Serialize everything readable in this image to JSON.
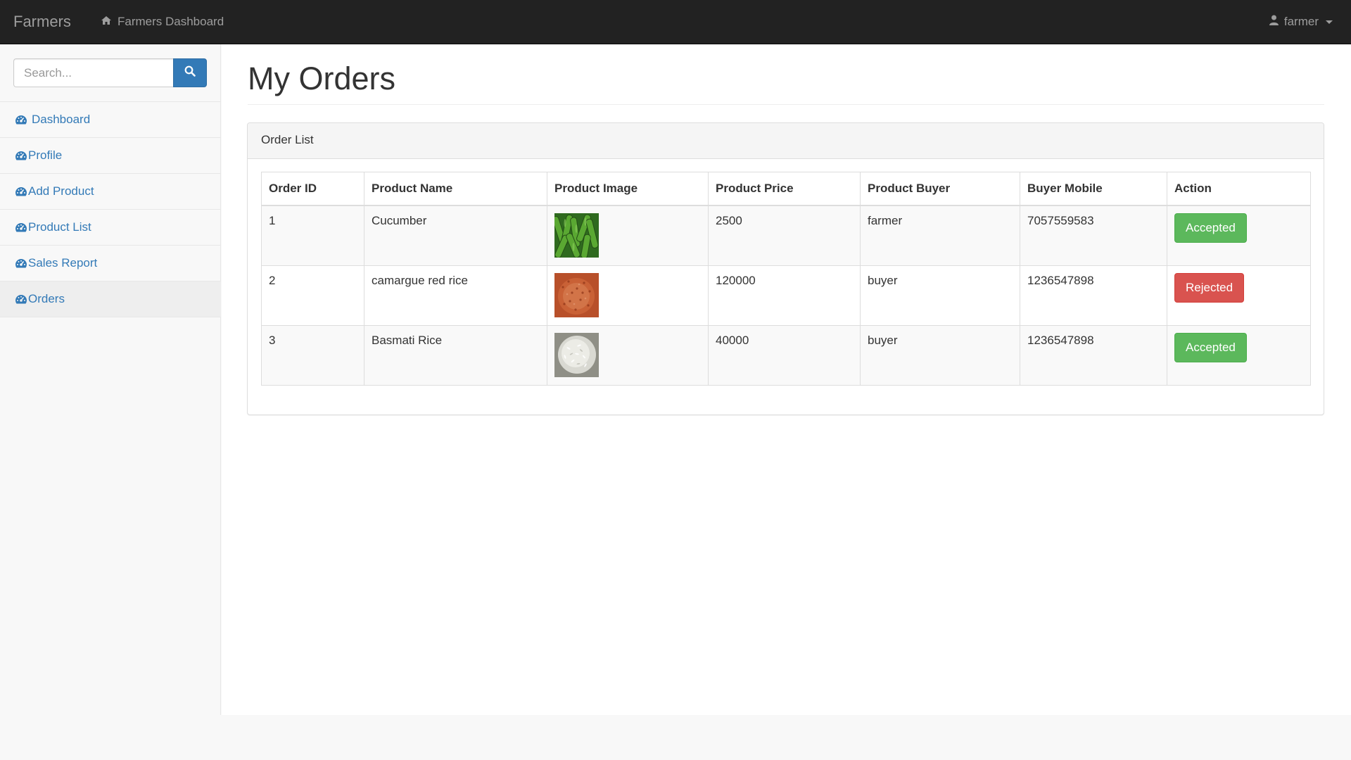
{
  "navbar": {
    "brand": "Farmers",
    "dashboard_link": "Farmers Dashboard",
    "user": "farmer"
  },
  "sidebar": {
    "search_placeholder": "Search...",
    "items": [
      {
        "label": "Dashboard",
        "icon": "dashboard-icon",
        "active": false
      },
      {
        "label": "Profile",
        "icon": "dashboard-icon",
        "active": false
      },
      {
        "label": "Add Product",
        "icon": "dashboard-icon",
        "active": false
      },
      {
        "label": "Product List",
        "icon": "dashboard-icon",
        "active": false
      },
      {
        "label": "Sales Report",
        "icon": "dashboard-icon",
        "active": false
      },
      {
        "label": "Orders",
        "icon": "dashboard-icon",
        "active": true
      }
    ]
  },
  "main": {
    "title": "My Orders",
    "panel_title": "Order List",
    "table": {
      "headers": [
        "Order ID",
        "Product Name",
        "Product Image",
        "Product Price",
        "Product Buyer",
        "Buyer Mobile",
        "Action"
      ],
      "rows": [
        {
          "id": "1",
          "name": "Cucumber",
          "image": "cucumber-image",
          "price": "2500",
          "buyer": "farmer",
          "mobile": "7057559583",
          "action": "Accepted",
          "status": "accepted"
        },
        {
          "id": "2",
          "name": "camargue red rice",
          "image": "red-rice-image",
          "price": "120000",
          "buyer": "buyer",
          "mobile": "1236547898",
          "action": "Rejected",
          "status": "rejected"
        },
        {
          "id": "3",
          "name": "Basmati Rice",
          "image": "basmati-rice-image",
          "price": "40000",
          "buyer": "buyer",
          "mobile": "1236547898",
          "action": "Accepted",
          "status": "accepted"
        }
      ]
    }
  },
  "colors": {
    "navbar_bg": "#222222",
    "link": "#337ab7",
    "success": "#5cb85c",
    "danger": "#d9534f"
  }
}
